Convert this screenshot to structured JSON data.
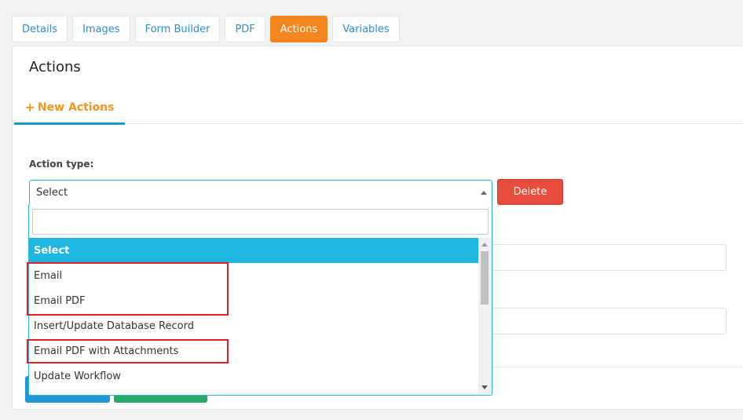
{
  "tabs": [
    {
      "label": "Details"
    },
    {
      "label": "Images"
    },
    {
      "label": "Form Builder"
    },
    {
      "label": "PDF"
    },
    {
      "label": "Actions",
      "active": true
    },
    {
      "label": "Variables"
    }
  ],
  "card": {
    "title": "Actions",
    "new_actions_icon": "+",
    "new_actions_label": "New Actions"
  },
  "form": {
    "action_type_label": "Action type:",
    "select_value": "Select",
    "delete_label": "Delete"
  },
  "dropdown": {
    "search_value": "",
    "options": [
      {
        "label": "Select",
        "highlighted": true
      },
      {
        "label": "Email"
      },
      {
        "label": "Email PDF"
      },
      {
        "label": "Insert/Update Database Record"
      },
      {
        "label": "Email PDF with Attachments"
      },
      {
        "label": "Update Workflow"
      }
    ]
  },
  "colors": {
    "active_tab": "#f4861f",
    "link": "#2b8ed8",
    "new_actions": "#f4961f",
    "highlight": "#1fb6e1",
    "delete": "#e74c3c",
    "annotation_box": "#e01f26"
  }
}
